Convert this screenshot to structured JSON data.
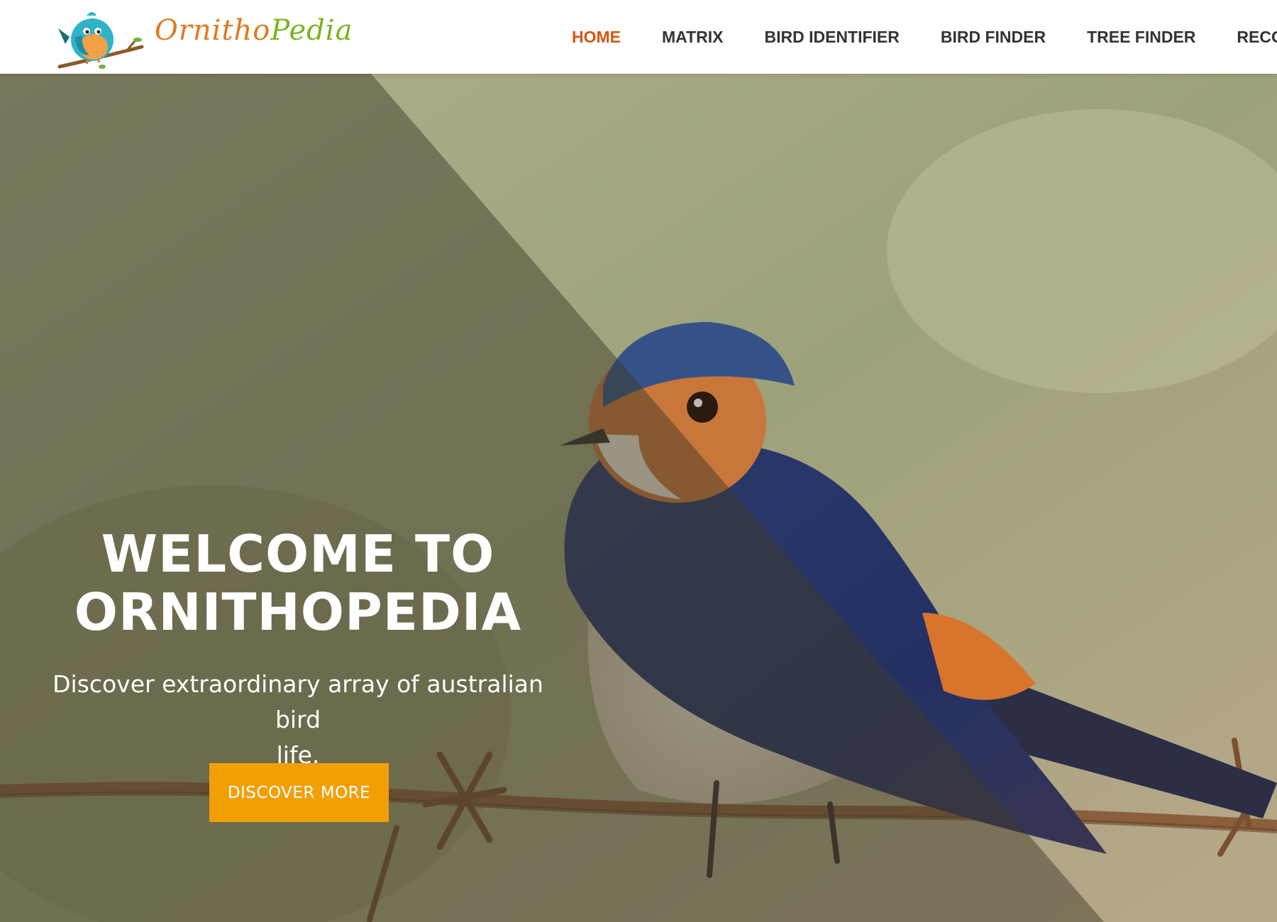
{
  "brand": {
    "name_part1": "Ornitho",
    "name_part2": "Pedia",
    "colors": {
      "orange": "#e07a1f",
      "green": "#7ab31f"
    },
    "logo_icon": "bluebird-on-branch-icon"
  },
  "nav": {
    "items": [
      {
        "label": "HOME",
        "active": true
      },
      {
        "label": "MATRIX",
        "active": false
      },
      {
        "label": "BIRD IDENTIFIER",
        "active": false
      },
      {
        "label": "BIRD FINDER",
        "active": false
      },
      {
        "label": "TREE FINDER",
        "active": false
      },
      {
        "label": "RECO",
        "active": false
      }
    ],
    "active_color": "#d4570f"
  },
  "hero": {
    "title_line1": "WELCOME TO",
    "title_line2": "ORNITHOPEDIA",
    "subtitle_line1": "Discover extraordinary array of australian bird",
    "subtitle_line2": "life.",
    "cta_label": "DISCOVER MORE",
    "cta_color": "#f29f05",
    "image_subject": "swallow-on-barbed-wire"
  }
}
